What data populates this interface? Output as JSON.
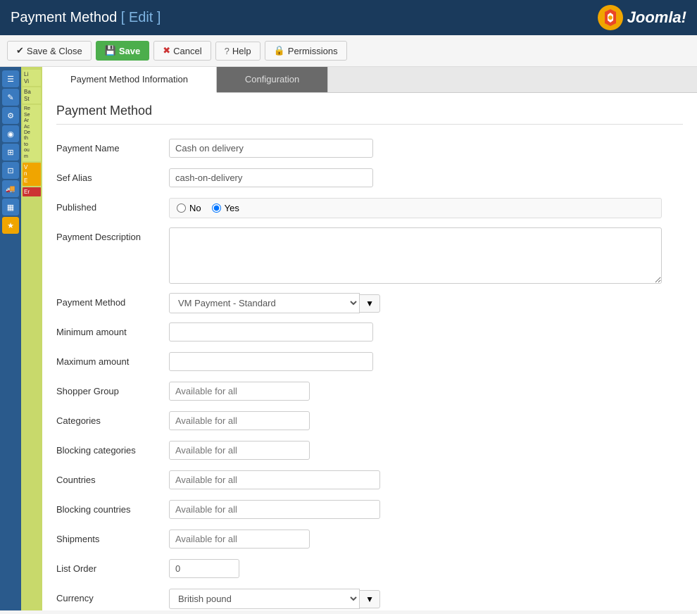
{
  "header": {
    "title": "Payment Method",
    "edit_label": "[ Edit ]",
    "joomla_text": "Joomla!"
  },
  "toolbar": {
    "save_close_label": "Save & Close",
    "save_label": "Save",
    "cancel_label": "Cancel",
    "help_label": "Help",
    "permissions_label": "Permissions"
  },
  "tabs": {
    "info_label": "Payment Method Information",
    "config_label": "Configuration"
  },
  "form": {
    "section_title": "Payment Method",
    "payment_name_label": "Payment Name",
    "payment_name_value": "Cash on delivery",
    "sef_alias_label": "Sef Alias",
    "sef_alias_value": "cash-on-delivery",
    "published_label": "Published",
    "published_no": "No",
    "published_yes": "Yes",
    "payment_description_label": "Payment Description",
    "payment_description_value": "",
    "payment_method_label": "Payment Method",
    "payment_method_value": "VM Payment - Standard",
    "minimum_amount_label": "Minimum amount",
    "minimum_amount_value": "",
    "maximum_amount_label": "Maximum amount",
    "maximum_amount_value": "",
    "shopper_group_label": "Shopper Group",
    "shopper_group_placeholder": "Available for all",
    "categories_label": "Categories",
    "categories_placeholder": "Available for all",
    "blocking_categories_label": "Blocking categories",
    "blocking_categories_placeholder": "Available for all",
    "countries_label": "Countries",
    "countries_placeholder": "Available for all",
    "blocking_countries_label": "Blocking countries",
    "blocking_countries_placeholder": "Available for all",
    "shipments_label": "Shipments",
    "shipments_placeholder": "Available for all",
    "list_order_label": "List Order",
    "list_order_value": "0",
    "currency_label": "Currency",
    "currency_value": "British pound"
  },
  "sidebar": {
    "icons": [
      "☰",
      "✎",
      "⚙",
      "◉",
      "⊞",
      "⊡",
      "🚚",
      "▦",
      "★"
    ]
  },
  "tooltip_panel": {
    "items": [
      "Li Vi",
      "Ba St",
      "Re Se Ar Ac De th to ou m",
      "V n E"
    ]
  }
}
